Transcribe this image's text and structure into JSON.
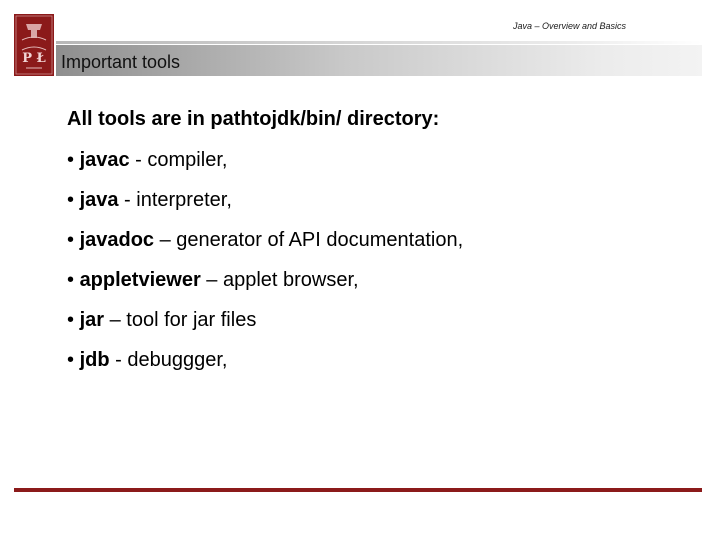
{
  "header": {
    "subtitle": "Java – Overview and Basics",
    "logo_letters": "P Ł"
  },
  "slide": {
    "title": "Important tools",
    "lead": "All tools are in pathtojdk/bin/ directory:",
    "items": [
      {
        "term": "javac",
        "desc": " - compiler,"
      },
      {
        "term": "java",
        "desc": " - interpreter,"
      },
      {
        "term": "javadoc",
        "desc": " – generator of API documentation,"
      },
      {
        "term": "appletviewer",
        "desc": " – applet browser,"
      },
      {
        "term": "jar",
        "desc": " – tool for jar files"
      },
      {
        "term": "jdb",
        "desc": " - debuggger,"
      }
    ],
    "bullet": "• "
  },
  "colors": {
    "accent": "#8b1a1a",
    "title_bar_start": "#8e8e8e",
    "title_bar_end": "#f3f3f3"
  }
}
